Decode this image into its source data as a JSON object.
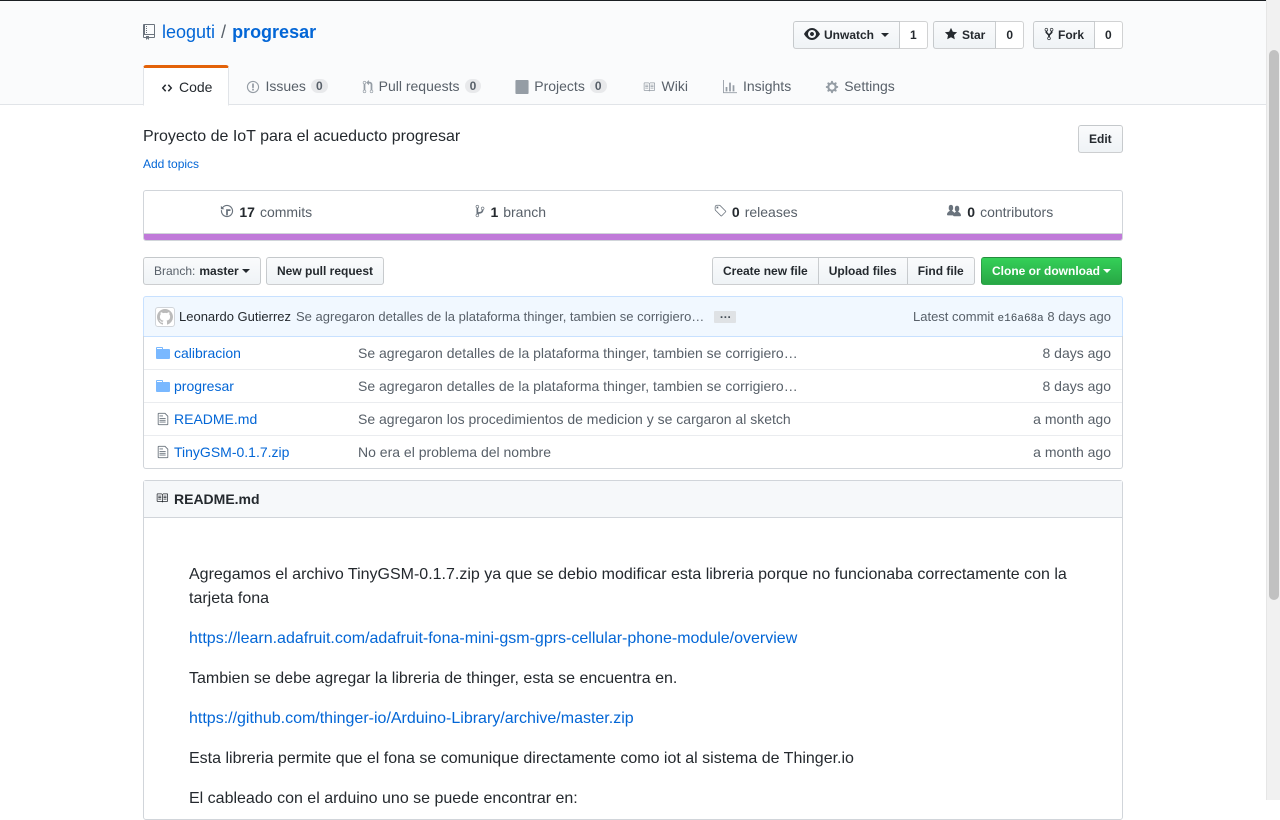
{
  "repo": {
    "owner": "leoguti",
    "separator": "/",
    "name": "progresar"
  },
  "actions": {
    "unwatch": {
      "label": "Unwatch",
      "count": "1"
    },
    "star": {
      "label": "Star",
      "count": "0"
    },
    "fork": {
      "label": "Fork",
      "count": "0"
    }
  },
  "tabs": [
    {
      "label": "Code",
      "counter": null
    },
    {
      "label": "Issues",
      "counter": "0"
    },
    {
      "label": "Pull requests",
      "counter": "0"
    },
    {
      "label": "Projects",
      "counter": "0"
    },
    {
      "label": "Wiki",
      "counter": null
    },
    {
      "label": "Insights",
      "counter": null
    },
    {
      "label": "Settings",
      "counter": null
    }
  ],
  "description": "Proyecto de IoT para el acueducto progresar",
  "add_topics": "Add topics",
  "edit_label": "Edit",
  "summary": {
    "commits": {
      "num": "17",
      "label": "commits"
    },
    "branches": {
      "num": "1",
      "label": "branch"
    },
    "releases": {
      "num": "0",
      "label": "releases"
    },
    "contributors": {
      "num": "0",
      "label": "contributors"
    }
  },
  "language_bar_color": "#c07ad9",
  "branch_select": {
    "prefix": "Branch:",
    "value": "master"
  },
  "buttons": {
    "new_pull_request": "New pull request",
    "create_new_file": "Create new file",
    "upload_files": "Upload files",
    "find_file": "Find file",
    "clone_or_download": "Clone or download"
  },
  "latest_commit": {
    "author": "Leonardo Gutierrez",
    "message": "Se agregaron detalles de la plataforma thinger, tambien se corrigiero…",
    "ellipsis": "…",
    "prefix": "Latest commit",
    "sha": "e16a68a",
    "age": "8 days ago"
  },
  "files": [
    {
      "type": "dir",
      "name": "calibracion",
      "message": "Se agregaron detalles de la plataforma thinger, tambien se corrigiero…",
      "age": "8 days ago"
    },
    {
      "type": "dir",
      "name": "progresar",
      "message": "Se agregaron detalles de la plataforma thinger, tambien se corrigiero…",
      "age": "8 days ago"
    },
    {
      "type": "file",
      "name": "README.md",
      "message": "Se agregaron los procedimientos de medicion y se cargaron al sketch",
      "age": "a month ago"
    },
    {
      "type": "file",
      "name": "TinyGSM-0.1.7.zip",
      "message": "No era el problema del nombre",
      "age": "a month ago"
    }
  ],
  "readme": {
    "title": "README.md",
    "p1": "Agregamos el archivo TinyGSM-0.1.7.zip ya que se debio modificar esta libreria porque no funcionaba correctamente con la tarjeta fona",
    "link1": "https://learn.adafruit.com/adafruit-fona-mini-gsm-gprs-cellular-phone-module/overview",
    "p2": "Tambien se debe agregar la libreria de thinger, esta se encuentra en.",
    "link2": "https://github.com/thinger-io/Arduino-Library/archive/master.zip",
    "p3": "Esta libreria permite que el fona se comunique directamente como iot al sistema de Thinger.io",
    "p4": "El cableado con el arduino uno se puede encontrar en:"
  }
}
